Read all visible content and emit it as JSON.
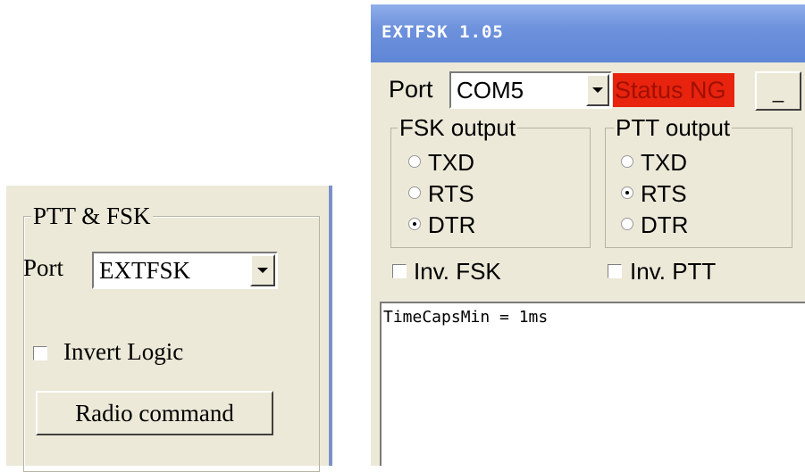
{
  "left_panel": {
    "group_title": "PTT & FSK",
    "port_label": "Port",
    "port_value": "EXTFSK",
    "invert_logic_label": "Invert Logic",
    "invert_logic_checked": false,
    "radio_command_label": "Radio command"
  },
  "right_window": {
    "title": "EXTFSK 1.05",
    "port_label": "Port",
    "port_value": "COM5",
    "status_text": "Status NG",
    "status_color": "#e8230e",
    "minimize_label": "_",
    "fsk_output": {
      "title": "FSK output",
      "options": [
        "TXD",
        "RTS",
        "DTR"
      ],
      "selected": "DTR"
    },
    "ptt_output": {
      "title": "PTT output",
      "options": [
        "TXD",
        "RTS",
        "DTR"
      ],
      "selected": "RTS"
    },
    "inv_fsk_label": "Inv. FSK",
    "inv_fsk_checked": false,
    "inv_ptt_label": "Inv. PTT",
    "inv_ptt_checked": false,
    "log_text": "TimeCapsMin = 1ms"
  },
  "colors": {
    "dialog_bg": "#ece9d8",
    "titlebar": "#6e92dc"
  }
}
